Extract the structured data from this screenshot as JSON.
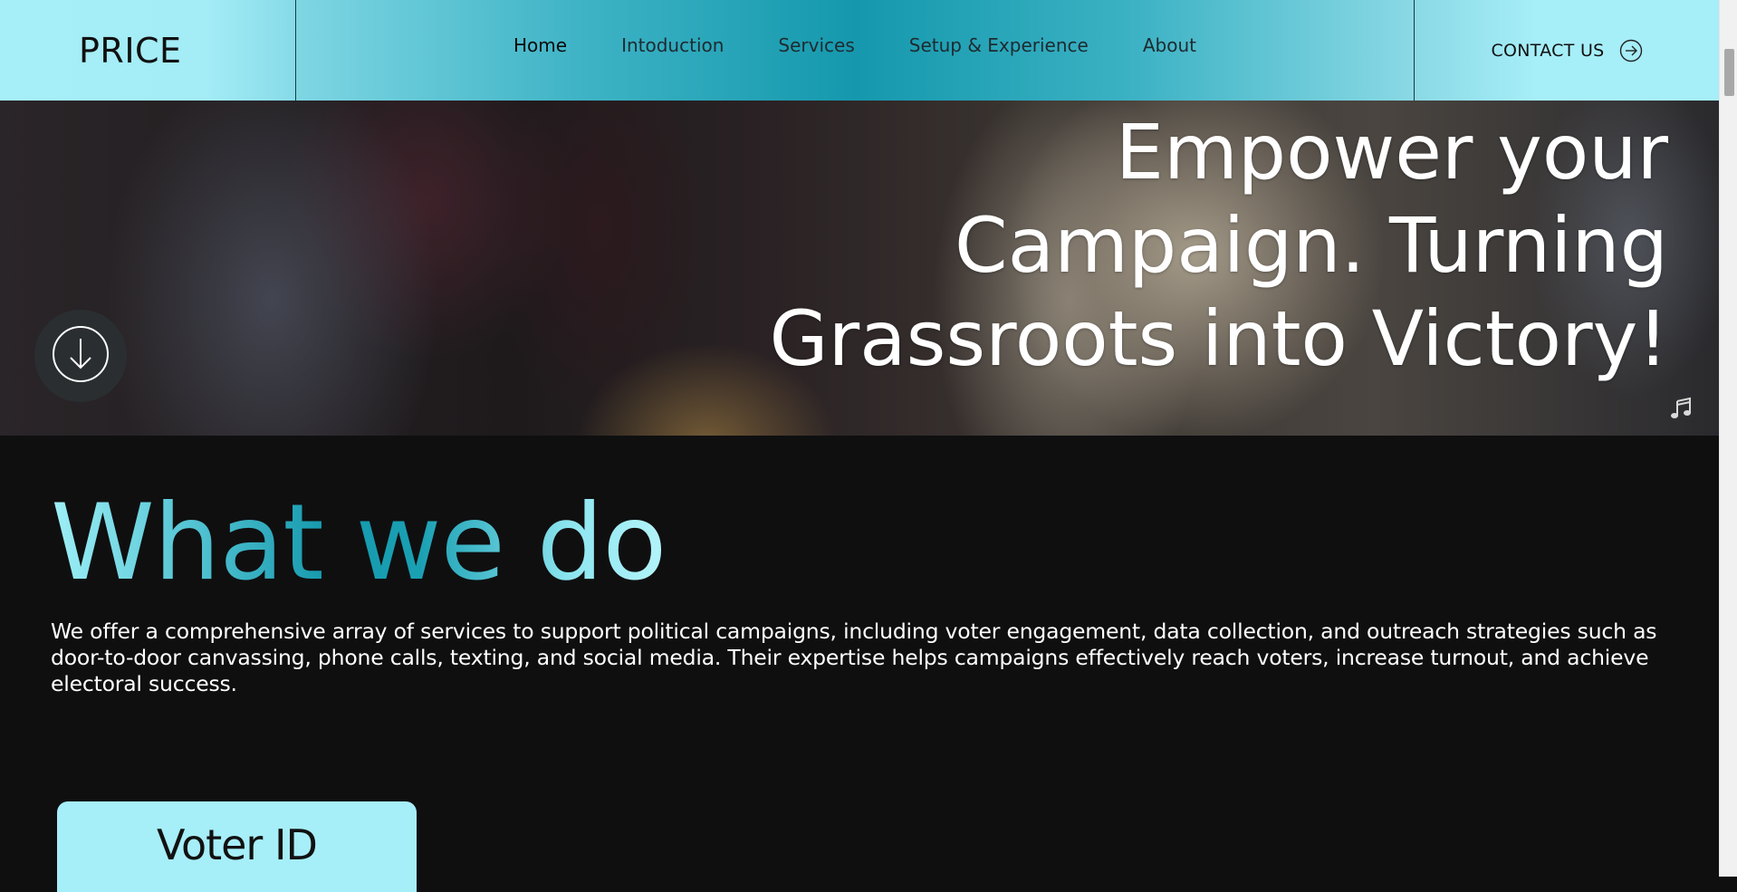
{
  "header": {
    "brand": "PRICE",
    "nav": [
      {
        "label": "Home",
        "active": true
      },
      {
        "label": "Intoduction",
        "active": false
      },
      {
        "label": "Services",
        "active": false
      },
      {
        "label": "Setup & Experience",
        "active": false
      },
      {
        "label": "About",
        "active": false
      }
    ],
    "contact_label": "CONTACT US",
    "contact_icon": "arrow-right-circle-icon"
  },
  "hero": {
    "title_lines": [
      "Empower your",
      "Campaign. Turning",
      "Grassroots into Victory!"
    ],
    "scroll_icon": "arrow-down-circle-icon",
    "music_icon": "music-note-icon"
  },
  "section": {
    "title": "What we do",
    "body": "We offer a comprehensive array of services to support political campaigns, including voter engagement, data collection, and outreach strategies such as door-to-door canvassing, phone calls, texting, and social media. Their expertise helps campaigns effectively reach voters, increase turnout, and achieve electoral success."
  },
  "cards": [
    {
      "title": "Voter ID"
    }
  ],
  "colors": {
    "accent_light": "#a6eef8",
    "accent_dark": "#1598ad",
    "background": "#0f0f10",
    "text_light": "#ffffff"
  }
}
